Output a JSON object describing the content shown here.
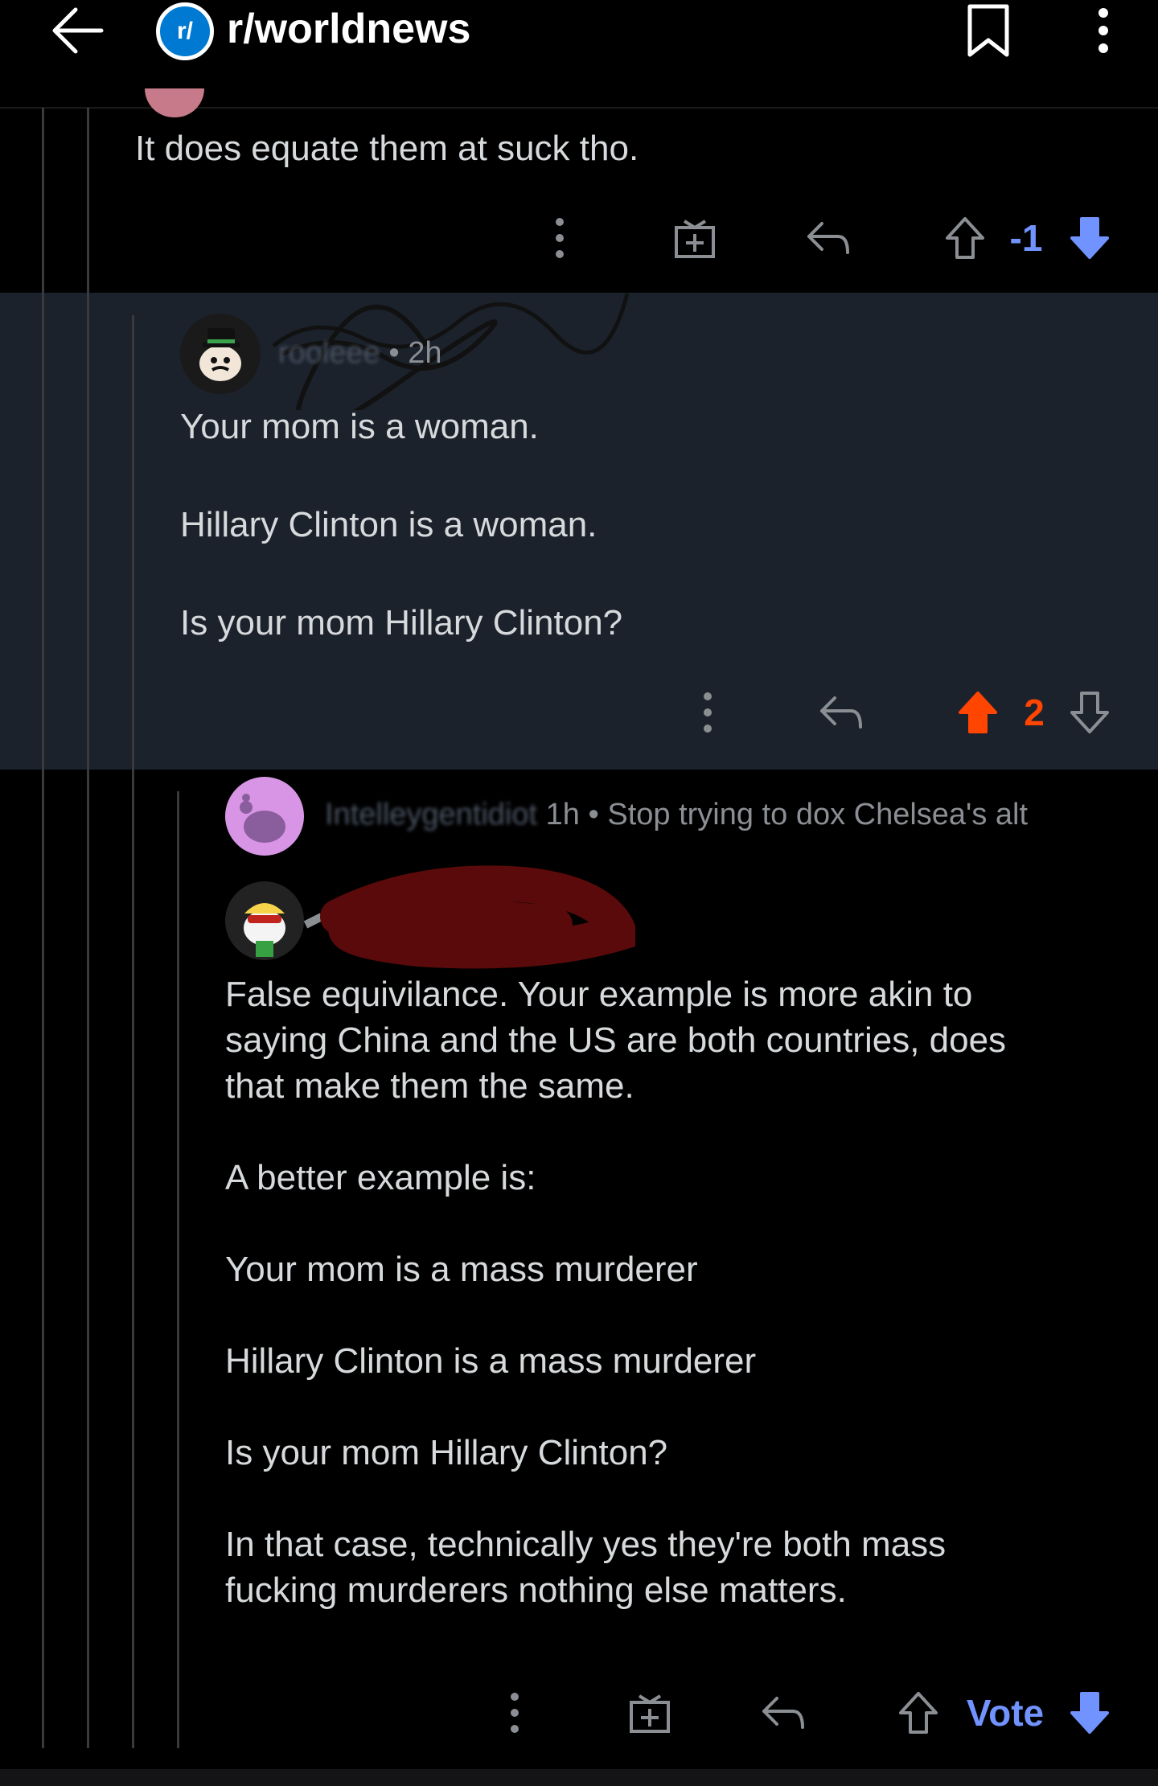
{
  "header": {
    "subreddit": "r/worldnews",
    "subreddit_icon": "r/",
    "icons": [
      "back-arrow-icon",
      "subreddit-icon",
      "bookmark-icon",
      "more-vert-icon"
    ]
  },
  "comments": [
    {
      "body": "It does equate them at suck tho.",
      "score": "-1",
      "vote_state": "downvoted"
    },
    {
      "author": "rooleee",
      "age": "2h",
      "body": "Your mom is a woman.\n\nHillary Clinton is a woman.\n\nIs your mom Hillary Clinton?",
      "score": "2",
      "vote_state": "upvoted"
    },
    {
      "author": "Intelleygentidiot",
      "age": "1h",
      "flair": "Stop trying to dox Chelsea's alt",
      "body": "False equivilance. Your example is more akin to\nsaying China and the US are both countries, does\nthat make them the same.\n\nA better example is:\n\nYour mom is a mass murderer\n\nHillary Clinton is a mass murderer\n\nIs your mom Hillary Clinton?\n\nIn that case, technically yes they're both mass\nfucking murderers nothing else matters.",
      "score": "Vote",
      "vote_state": "downvoted"
    }
  ],
  "separator": "•",
  "colors": {
    "upvote": "#ff4500",
    "downvote": "#7193ff",
    "background": "#000000",
    "highlight_bg": "#1c222c",
    "text": "#d7dadc",
    "meta": "#8b8f94"
  }
}
